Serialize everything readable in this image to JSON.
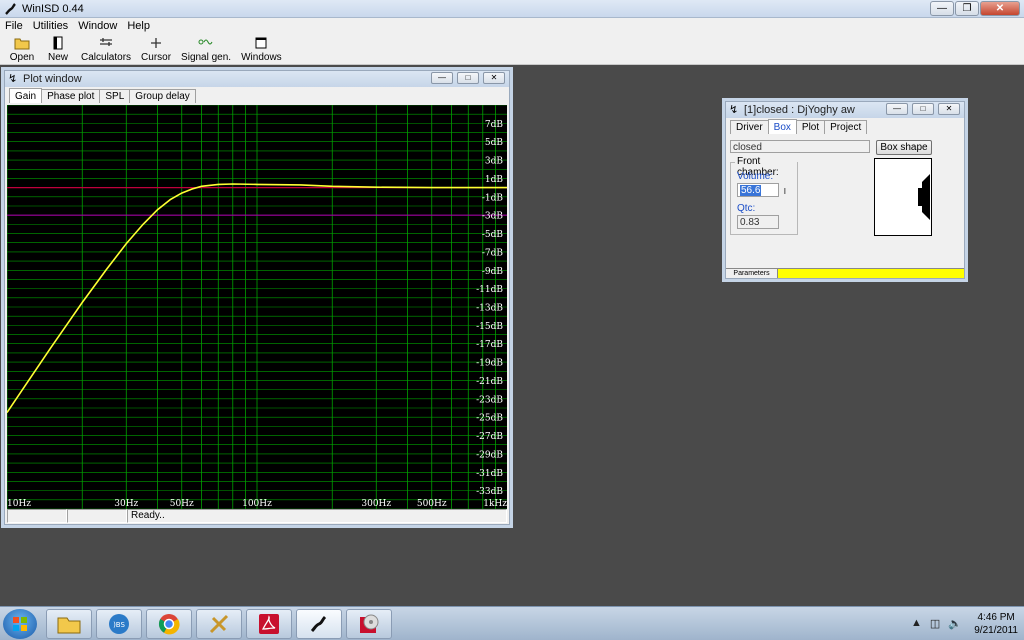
{
  "app": {
    "title": "WinISD 0.44"
  },
  "menu": [
    "File",
    "Utilities",
    "Window",
    "Help"
  ],
  "toolbar": [
    {
      "label": "Open",
      "icon": "folder-icon"
    },
    {
      "label": "New",
      "icon": "new-icon"
    },
    {
      "label": "Calculators",
      "icon": "calculator-icon"
    },
    {
      "label": "Cursor",
      "icon": "cursor-icon"
    },
    {
      "label": "Signal gen.",
      "icon": "signal-icon"
    },
    {
      "label": "Windows",
      "icon": "windows-icon"
    }
  ],
  "plot_window": {
    "title": "Plot window",
    "tabs": [
      "Gain",
      "Phase plot",
      "SPL",
      "Group delay"
    ],
    "status": [
      "",
      "",
      "Ready.."
    ]
  },
  "chart_data": {
    "type": "line",
    "x_scale": "log",
    "xlim": [
      10,
      1000
    ],
    "ylim": [
      -35,
      9
    ],
    "x_tick_labels": [
      "10Hz",
      "30Hz",
      "50Hz",
      "100Hz",
      "300Hz",
      "500Hz",
      "1kHz"
    ],
    "x_ticks": [
      10,
      30,
      50,
      100,
      300,
      500,
      1000
    ],
    "y_tick_labels": [
      "7dB",
      "5dB",
      "3dB",
      "1dB",
      "-1dB",
      "-3dB",
      "-5dB",
      "-7dB",
      "-9dB",
      "-11dB",
      "-13dB",
      "-15dB",
      "-17dB",
      "-19dB",
      "-21dB",
      "-23dB",
      "-25dB",
      "-27dB",
      "-29dB",
      "-31dB",
      "-33dB"
    ],
    "y_ticks": [
      7,
      5,
      3,
      1,
      -1,
      -3,
      -5,
      -7,
      -9,
      -11,
      -13,
      -15,
      -17,
      -19,
      -21,
      -23,
      -25,
      -27,
      -29,
      -31,
      -33
    ],
    "reference_lines": [
      {
        "y": 0,
        "color": "#c0003c"
      },
      {
        "y": -3,
        "color": "#a000a0"
      }
    ],
    "series": [
      {
        "color": "#ffff33",
        "x": [
          10,
          12,
          15,
          18,
          20,
          25,
          30,
          35,
          40,
          45,
          50,
          55,
          60,
          70,
          80,
          100,
          150,
          200,
          300,
          500,
          1000
        ],
        "y": [
          -24.5,
          -21.3,
          -17.4,
          -14.3,
          -12.5,
          -8.9,
          -6.1,
          -4.0,
          -2.4,
          -1.3,
          -0.6,
          -0.15,
          0.15,
          0.35,
          0.4,
          0.35,
          0.3,
          0.15,
          0.05,
          0.0,
          0.0
        ]
      }
    ],
    "grid": true,
    "colors": {
      "background": "#000000",
      "grid": "#00a000",
      "axis_text": "#ffffff"
    }
  },
  "box_window": {
    "title": "[1]closed : DjYoghy aw",
    "tabs": [
      "Driver",
      "Box",
      "Plot",
      "Project"
    ],
    "box_type": "closed",
    "box_shape_label": "Box shape",
    "group_label": "Front chamber:",
    "volume_label": "Volume:",
    "volume_value": "56.6",
    "volume_unit": "l",
    "qtc_label": "Qtc:",
    "qtc_value": "0.83",
    "status_label": "Parameters"
  },
  "tray": {
    "time": "4:46 PM",
    "date": "9/21/2011"
  }
}
